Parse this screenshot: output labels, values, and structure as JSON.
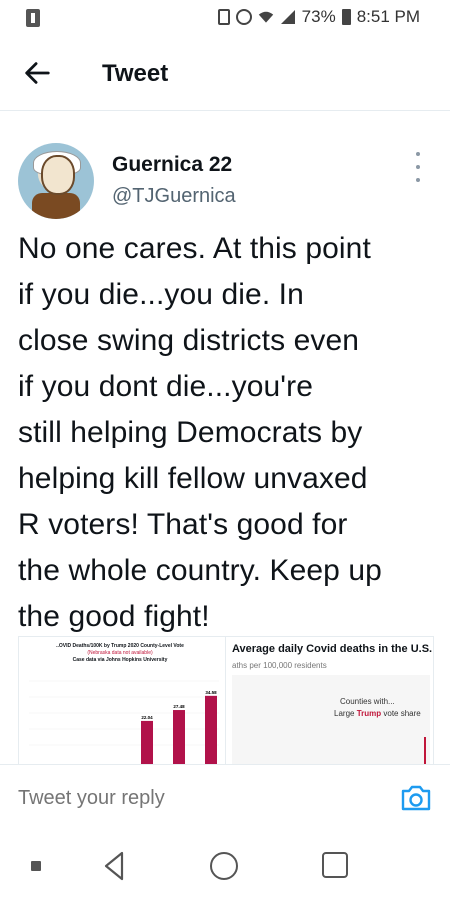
{
  "status_bar": {
    "battery": "73%",
    "time": "8:51 PM"
  },
  "header": {
    "title": "Tweet"
  },
  "tweet": {
    "author_name": "Guernica 22",
    "author_handle": "@TJGuernica",
    "text": "No one cares. At this point\nif you die...you die. In\nclose swing districts even\nif you dont die...you're\nstill helping Democrats by\nhelping kill fellow unvaxed\nR voters! That's good for\nthe whole country. Keep up\nthe good fight!"
  },
  "media": {
    "image1": {
      "title": "..OVID Deaths/100K by Trump 2020 County-Level Vote",
      "subtitle": "(Nebraska data not available)",
      "source": "Case data via Johns Hopkins University"
    },
    "image2": {
      "title": "Average daily Covid deaths in the U.S.",
      "subtitle": "aths per 100,000 residents",
      "legend_line1": "Counties with...",
      "legend_prefix": "Large ",
      "legend_trump": "Trump",
      "legend_suffix": " vote share"
    }
  },
  "chart_data": {
    "type": "bar",
    "title": "..OVID Deaths/100K by Trump 2020 County-Level Vote",
    "categories": [
      "",
      "",
      ""
    ],
    "values": [
      22.04,
      27.48,
      34.58
    ],
    "labels": [
      "22.04",
      "27.48",
      "34.58"
    ],
    "colors": {
      "bar": "#b1124a"
    }
  },
  "reply": {
    "placeholder": "Tweet your reply"
  },
  "colors": {
    "accent": "#1d9bf0",
    "text": "#0f1419",
    "muted": "#536471"
  },
  "icons": {
    "back": "arrow-left-icon",
    "more": "more-vertical-icon",
    "camera": "camera-icon",
    "nav_recent": "nav-recent-icon",
    "nav_back": "nav-back-icon",
    "nav_home": "nav-home-icon",
    "nav_overview": "nav-overview-icon"
  }
}
